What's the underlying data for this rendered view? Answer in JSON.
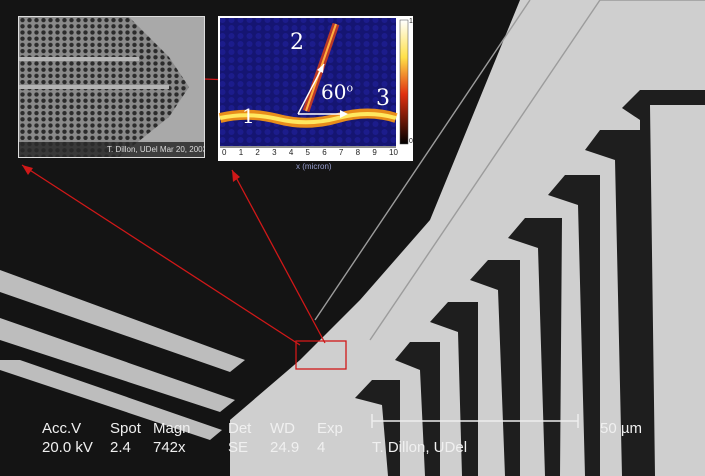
{
  "colors": {
    "background": "#141414",
    "waveguide_bright": "#cfcfcf",
    "waveguide_dark": "#1e1e1e",
    "annotation_red": "#d01818",
    "field_bg": "#1a1a78",
    "field_hot": "#ffcc33"
  },
  "inset_sem": {
    "caption": "T. Dillon, UDel Mar 20, 2003"
  },
  "inset_field": {
    "x_ticks": [
      "0",
      "1",
      "2",
      "3",
      "4",
      "5",
      "6",
      "7",
      "8",
      "9",
      "10"
    ],
    "x_axis_label": "x (micron)",
    "colorbar_ticks": [
      "1",
      "0"
    ],
    "label_1": "1",
    "label_2": "2",
    "label_3": "3",
    "angle_label": "60",
    "angle_unit": "o"
  },
  "info_bar": {
    "headers": [
      "Acc.V",
      "Spot",
      "Magn",
      "Det",
      "WD",
      "Exp"
    ],
    "values": [
      "20.0 kV",
      "2.4",
      "742x",
      "SE",
      "24.9",
      "4"
    ],
    "scale_label": "50 µm",
    "operator": "T. Dillon, UDel"
  }
}
